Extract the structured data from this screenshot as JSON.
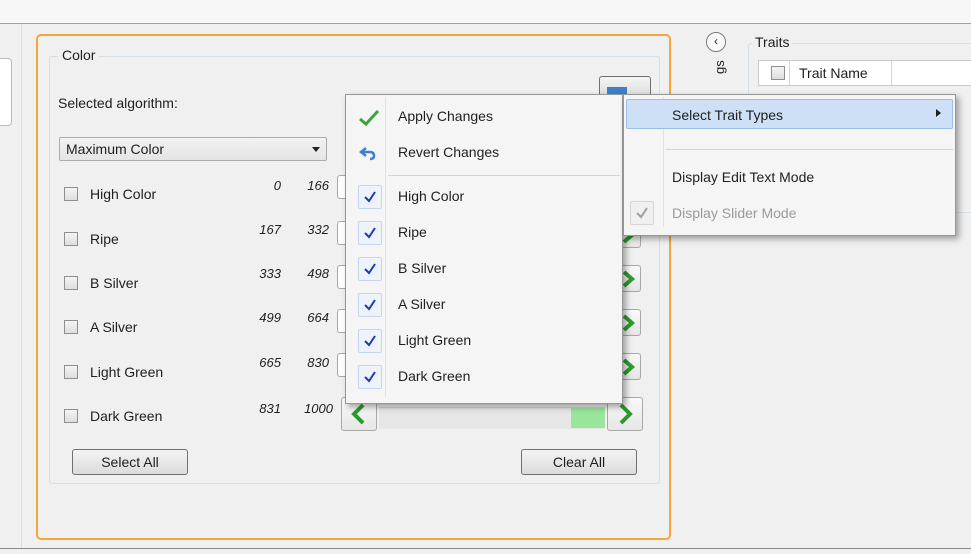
{
  "color_group": {
    "title": "Color",
    "algorithm_label": "Selected algorithm:",
    "algorithm_value": "Maximum Color",
    "rows": [
      {
        "label": "High Color",
        "min": "0",
        "max": "166"
      },
      {
        "label": "Ripe",
        "min": "167",
        "max": "332"
      },
      {
        "label": "B Silver",
        "min": "333",
        "max": "498"
      },
      {
        "label": "A Silver",
        "min": "499",
        "max": "664"
      },
      {
        "label": "Light Green",
        "min": "665",
        "max": "830"
      },
      {
        "label": "Dark Green",
        "min": "831",
        "max": "1000"
      }
    ],
    "select_all": "Select All",
    "clear_all": "Clear All"
  },
  "context_menu": {
    "apply": "Apply Changes",
    "revert": "Revert Changes",
    "items": [
      "High Color",
      "Ripe",
      "B Silver",
      "A Silver",
      "Light Green",
      "Dark Green"
    ]
  },
  "submenu": {
    "select_trait_types": "Select Trait Types",
    "edit_text_mode": "Display Edit Text Mode",
    "slider_mode": "Display Slider Mode"
  },
  "right_panel": {
    "collapse_icon": "‹",
    "vertical_label": "gs",
    "traits_title": "Traits",
    "column_header": "Trait Name"
  },
  "colors": {
    "panel_border": "#f5a53b",
    "highlight": "#cde0f5",
    "check": "#1a3fb4",
    "apply_green": "#3aa63a",
    "nav_green": "#2e9a2e"
  }
}
